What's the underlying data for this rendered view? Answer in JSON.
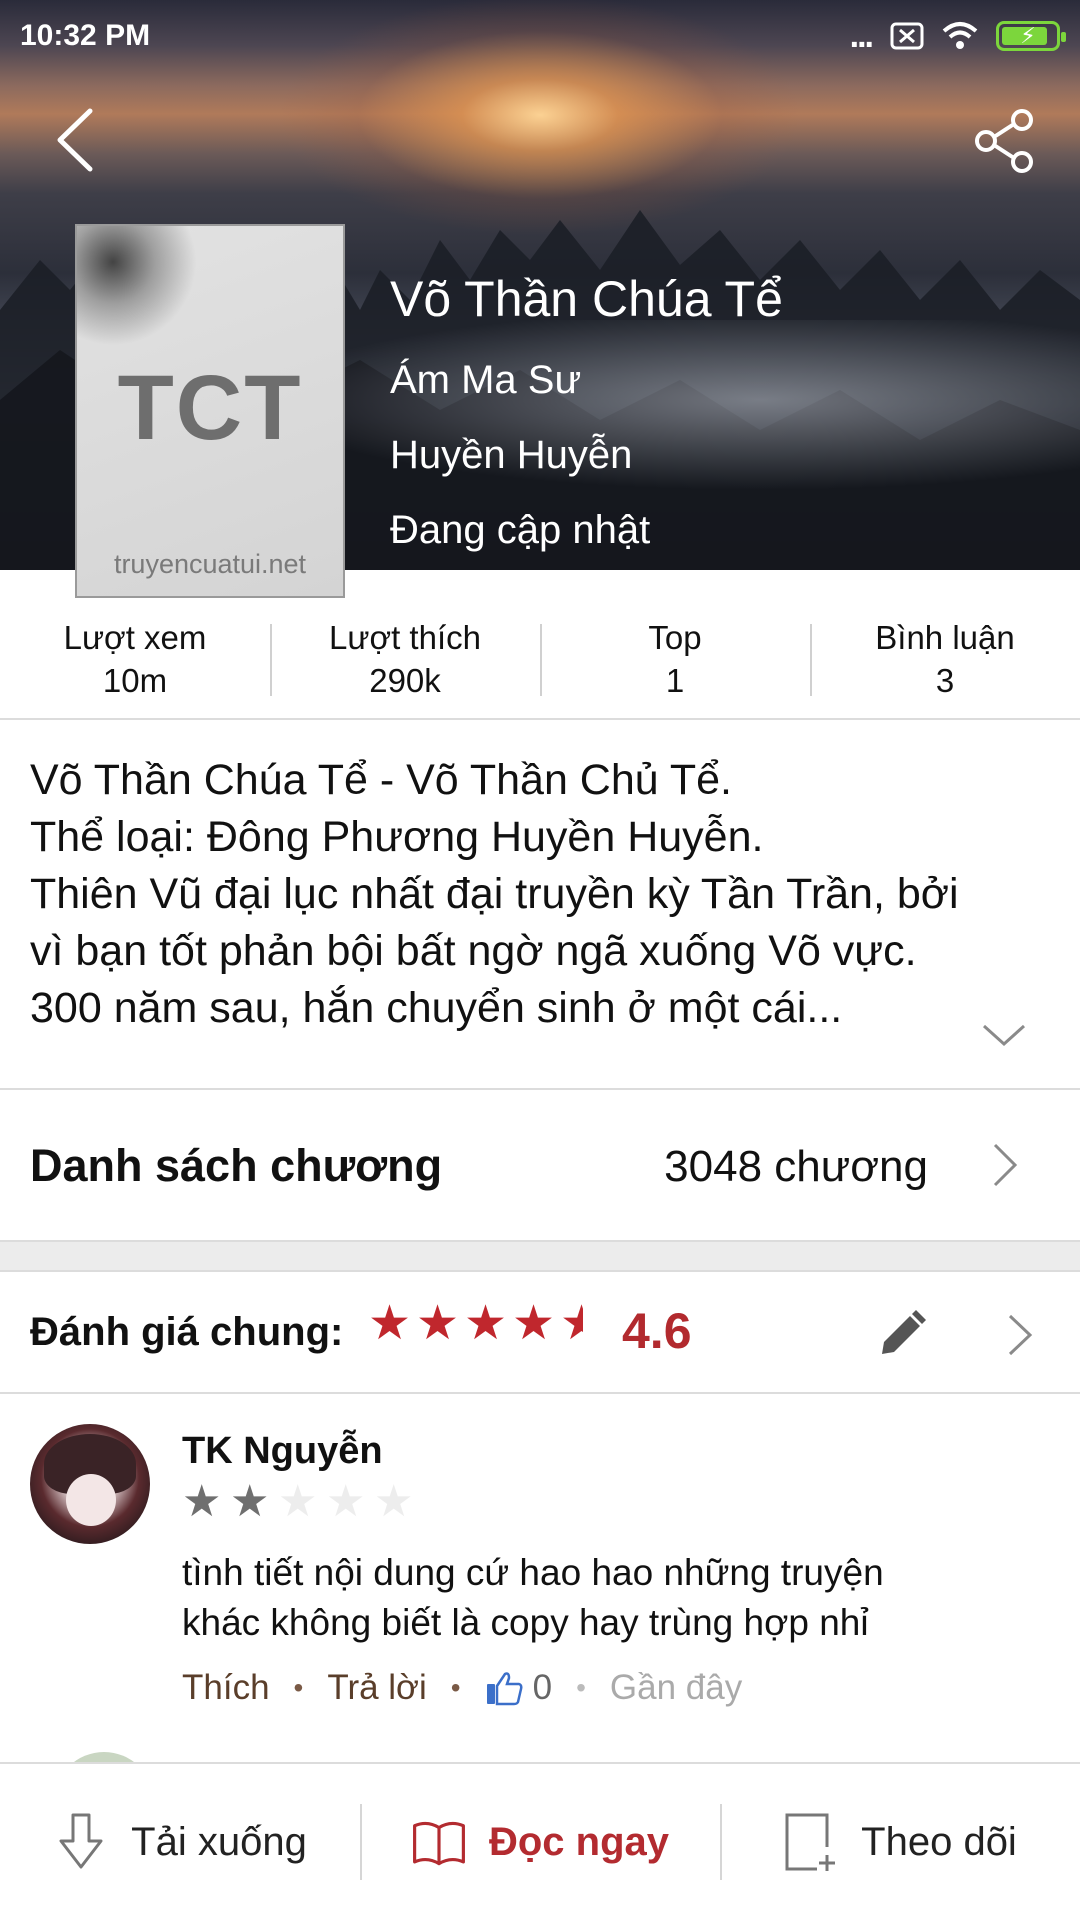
{
  "status_bar": {
    "time": "10:32 PM",
    "more": "..."
  },
  "book": {
    "title": "Võ Thần Chúa Tể",
    "author": "Ám Ma Sư",
    "genre": "Huyền Huyễn",
    "status": "Đang cập nhật",
    "cover_logo": "TCT",
    "cover_site": "truyencuatui.net"
  },
  "stats": [
    {
      "label": "Lượt xem",
      "value": "10m"
    },
    {
      "label": "Lượt thích",
      "value": "290k"
    },
    {
      "label": "Top",
      "value": "1"
    },
    {
      "label": "Bình luận",
      "value": "3"
    }
  ],
  "description": {
    "lines": [
      "Võ Thần Chúa Tể - Võ Thần Chủ Tể.",
      "Thể loại: Đông Phương Huyền Huyễn.",
      "Thiên Vũ đại lục nhất đại truyền kỳ Tần Trần, bởi",
      "vì bạn tốt phản bội bất ngờ ngã xuống Võ vực.",
      "300 năm sau, hắn chuyển sinh ở một cái..."
    ]
  },
  "chapters": {
    "label": "Danh sách chương",
    "count": "3048 chương"
  },
  "rating": {
    "label": "Đánh giá chung:",
    "score": "4.6",
    "value": 4.6,
    "max": 5
  },
  "comment": {
    "user": "TK Nguyễn",
    "stars": 2,
    "max_stars": 5,
    "text_lines": [
      "tình tiết nội dung cứ hao hao những truyện",
      "khác không biết là copy hay trùng hợp nhỉ"
    ],
    "like_label": "Thích",
    "reply_label": "Trả lời",
    "like_count": "0",
    "time": "Gần đây"
  },
  "bottom_bar": {
    "download": "Tải xuống",
    "read": "Đọc ngay",
    "follow": "Theo dõi"
  },
  "colors": {
    "accent": "#b32b30",
    "star_red": "#c0272d",
    "star_gray": "#6f6f6f"
  }
}
